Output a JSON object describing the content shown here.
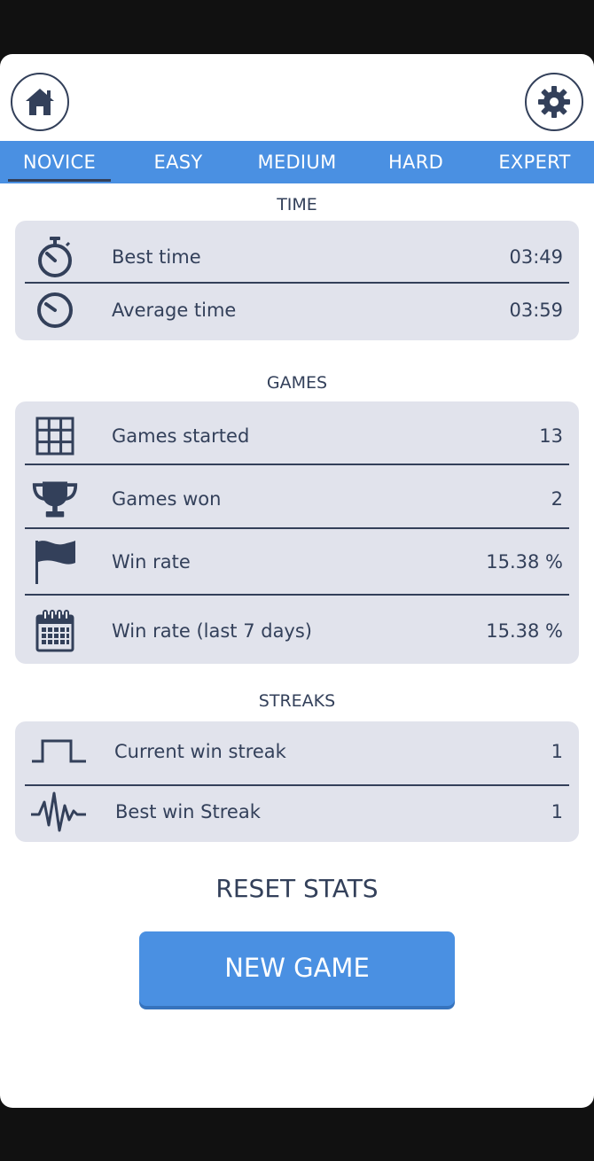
{
  "header": {
    "home_icon": "home-icon",
    "settings_icon": "gear-icon"
  },
  "tabs": [
    {
      "label": "NOVICE",
      "active": true
    },
    {
      "label": "EASY",
      "active": false
    },
    {
      "label": "MEDIUM",
      "active": false
    },
    {
      "label": "HARD",
      "active": false
    },
    {
      "label": "EXPERT",
      "active": false
    }
  ],
  "time": {
    "title": "TIME",
    "rows": [
      {
        "label": "Best time",
        "value": "03:49",
        "icon": "stopwatch-icon"
      },
      {
        "label": "Average time",
        "value": "03:59",
        "icon": "gauge-icon"
      }
    ]
  },
  "games": {
    "title": "GAMES",
    "rows": [
      {
        "label": "Games started",
        "value": "13",
        "icon": "grid-icon"
      },
      {
        "label": "Games won",
        "value": "2",
        "icon": "trophy-icon"
      },
      {
        "label": "Win rate",
        "value": "15.38 %",
        "icon": "flag-icon"
      },
      {
        "label": "Win rate (last 7 days)",
        "value": "15.38 %",
        "icon": "calendar-icon"
      }
    ]
  },
  "streaks": {
    "title": "STREAKS",
    "rows": [
      {
        "label": "Current win streak",
        "value": "1",
        "icon": "step-wave-icon"
      },
      {
        "label": "Best win Streak",
        "value": "1",
        "icon": "pulse-icon"
      }
    ]
  },
  "actions": {
    "reset_label": "RESET STATS",
    "new_game_label": "NEW GAME"
  },
  "colors": {
    "accent": "#4a90e2",
    "text": "#33405a",
    "card": "#e1e3ec"
  }
}
